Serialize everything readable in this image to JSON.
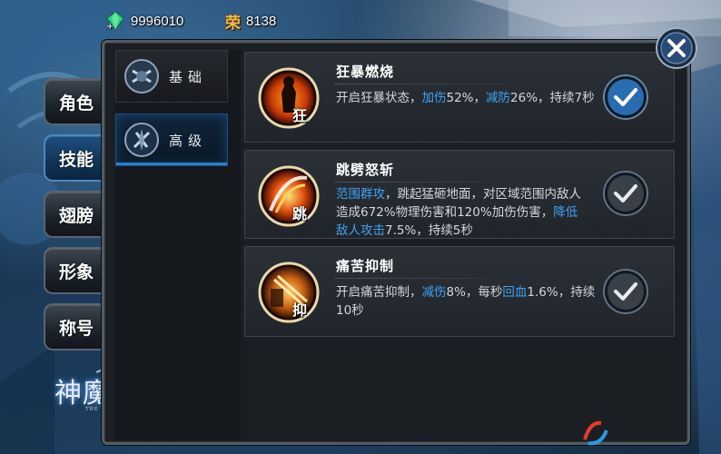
{
  "resources": {
    "gem_value": "9996010",
    "honor_icon_text": "荣",
    "honor_value": "8138"
  },
  "side_tabs": [
    {
      "label": "角色",
      "active": false
    },
    {
      "label": "技能",
      "active": true
    },
    {
      "label": "翅膀",
      "active": false
    },
    {
      "label": "形象",
      "active": false
    },
    {
      "label": "称号",
      "active": false
    }
  ],
  "sub_tabs": [
    {
      "label": "基础",
      "active": true
    },
    {
      "label": "高级",
      "active": false
    }
  ],
  "skills": [
    {
      "name": "狂暴燃烧",
      "badge": "狂",
      "icon": "berserk-icon",
      "desc_parts": [
        {
          "text": "开启狂暴状态，",
          "hl": false
        },
        {
          "text": "加伤",
          "hl": true
        },
        {
          "text": "52%，",
          "hl": false
        },
        {
          "text": "减防",
          "hl": true
        },
        {
          "text": "26%，持续7秒",
          "hl": false
        }
      ],
      "selected": true
    },
    {
      "name": "跳劈怒斩",
      "badge": "跳",
      "icon": "leap-slash-icon",
      "desc_parts": [
        {
          "text": "范围群攻",
          "hl": true
        },
        {
          "text": "，跳起猛砸地面，对区域范围内敌人造成672%物理伤害和120%加伤伤害，",
          "hl": false
        },
        {
          "text": "降低敌人攻击",
          "hl": true
        },
        {
          "text": "7.5%，持续5秒",
          "hl": false
        }
      ],
      "selected": false
    },
    {
      "name": "痛苦抑制",
      "badge": "抑",
      "icon": "suppress-icon",
      "desc_parts": [
        {
          "text": "开启痛苦抑制，",
          "hl": false
        },
        {
          "text": "减伤",
          "hl": true
        },
        {
          "text": "8%，每秒",
          "hl": false
        },
        {
          "text": "回血",
          "hl": true
        },
        {
          "text": "1.6%，持续10秒",
          "hl": false
        }
      ],
      "selected": false
    }
  ],
  "logo": {
    "title": "神魔圣域",
    "subtitle": "THE SPIRIT OF CHAOS"
  },
  "colors": {
    "highlight": "#3fa2f2",
    "active_tab": "#1e4f80",
    "selected_check": "#2a6cb0",
    "unselected_check": "#3a4048"
  }
}
